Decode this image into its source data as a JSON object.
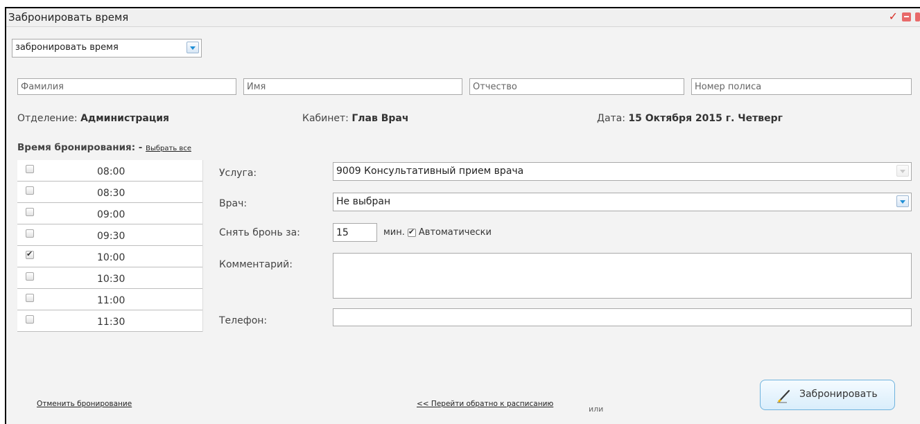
{
  "window": {
    "title": "Забронировать время"
  },
  "mode_select": {
    "value": "забронировать время"
  },
  "patient": {
    "last_name_placeholder": "Фамилия",
    "first_name_placeholder": "Имя",
    "middle_name_placeholder": "Отчество",
    "policy_placeholder": "Номер полиса"
  },
  "info": {
    "department_label": "Отделение:",
    "department_value": "Администрация",
    "cabinet_label": "Кабинет:",
    "cabinet_value": "Глав Врач",
    "date_label": "Дата:",
    "date_value": "15 Октября 2015 г. Четверг"
  },
  "booking": {
    "section_title": "Время бронирования: -",
    "select_all": "Выбрать все",
    "slots": [
      {
        "time": "08:00",
        "checked": false
      },
      {
        "time": "08:30",
        "checked": false
      },
      {
        "time": "09:00",
        "checked": false
      },
      {
        "time": "09:30",
        "checked": false
      },
      {
        "time": "10:00",
        "checked": true
      },
      {
        "time": "10:30",
        "checked": false
      },
      {
        "time": "11:00",
        "checked": false
      },
      {
        "time": "11:30",
        "checked": false
      }
    ]
  },
  "form": {
    "service_label": "Услуга:",
    "service_value": "9009 Консультативный прием врача",
    "doctor_label": "Врач:",
    "doctor_value": "Не выбран",
    "release_label": "Снять бронь за:",
    "release_value": "15",
    "minutes_label": "мин.",
    "auto_label": "Автоматически",
    "comment_label": "Комментарий:",
    "phone_label": "Телефон:"
  },
  "footer": {
    "cancel_link": "Отменить бронирование",
    "back_link": "<< Перейти обратно к расписанию",
    "or_text": "или",
    "book_button": "Забронировать"
  }
}
